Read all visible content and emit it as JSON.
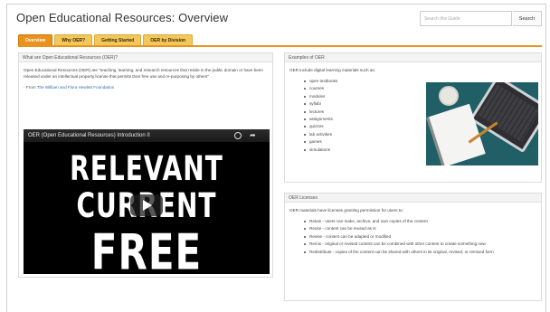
{
  "page": {
    "title": "Open Educational Resources: Overview"
  },
  "search": {
    "placeholder": "Search this Guide",
    "button_label": "Search"
  },
  "tabs": [
    {
      "label": "Overview",
      "active": true
    },
    {
      "label": "Why OER?",
      "active": false
    },
    {
      "label": "Getting Started",
      "active": false
    },
    {
      "label": "OER by Division",
      "active": false
    }
  ],
  "what_panel": {
    "heading": "What are Open Educational Resources (OER)?",
    "intro": "Open Educational Resources (OER) are \"teaching, learning, and research resources that reside in the public domain or have been released under an intellectual property license that permits their free use and re-purposing by others\"",
    "from_prefix": "- From ",
    "from_link": "The William and Flora Hewlett Foundation"
  },
  "video": {
    "title": "OER (Open Educational Resources) Introduction II",
    "lines": [
      "RELEVANT",
      "CURRENT",
      "FREE"
    ]
  },
  "examples_panel": {
    "heading": "Examples of OER",
    "intro": "OER include digital learning materials such as:",
    "items": [
      "open textbooks",
      "courses",
      "modules",
      "syllabi",
      "lectures",
      "assignments",
      "quizzes",
      "lab activities",
      "games",
      "simulations"
    ]
  },
  "licenses_panel": {
    "heading": "OER Licenses",
    "intro": "OER materials have licenses granting permission for users to:",
    "items": [
      "Retain - users can make, archive, and own copies of the content",
      "Reuse - content can be reused as is",
      "Revise - content can be adapted or modified",
      "Remix - original or revised content can be combined with other content to create something new",
      "Redistribute - copies of the content can be shared with others in its original, revised, or remixed form"
    ]
  },
  "colors": {
    "tab_active": "#e9931d",
    "tab_inactive": "#f2c75c",
    "link": "#2a6db0"
  }
}
